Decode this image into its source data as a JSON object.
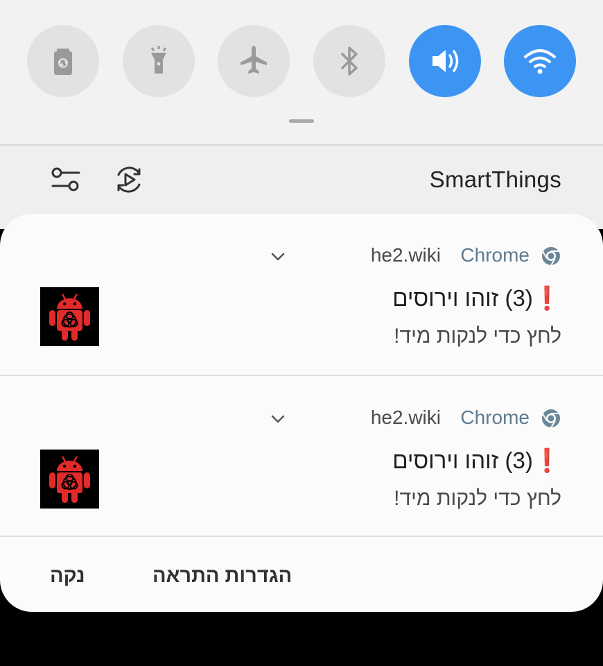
{
  "quick_settings": {
    "tiles": [
      {
        "name": "battery-saver-icon",
        "active": false
      },
      {
        "name": "flashlight-icon",
        "active": false
      },
      {
        "name": "airplane-mode-icon",
        "active": false
      },
      {
        "name": "bluetooth-icon",
        "active": false
      },
      {
        "name": "sound-icon",
        "active": true
      },
      {
        "name": "wifi-icon",
        "active": true
      }
    ],
    "accent_color": "#3d95f3",
    "inactive_color": "#e2e2e2"
  },
  "toolbar": {
    "smartthings_label": "SmartThings",
    "icons": [
      "settings-sliders-icon",
      "media-output-icon"
    ]
  },
  "notifications": [
    {
      "source": "he2.wiki",
      "app": "Chrome",
      "title": "(3) זוהו וירוסים",
      "title_suffix": "❗",
      "body": "לחץ כדי לנקות מיד!",
      "thumbnail_icon": "red-android-biohazard-icon"
    },
    {
      "source": "he2.wiki",
      "app": "Chrome",
      "title": "(3) זוהו וירוסים",
      "title_suffix": "❗",
      "body": "לחץ כדי לנקות מיד!",
      "thumbnail_icon": "red-android-biohazard-icon"
    }
  ],
  "actions": {
    "clear_label": "נקה",
    "settings_label": "הגדרות התראה"
  }
}
